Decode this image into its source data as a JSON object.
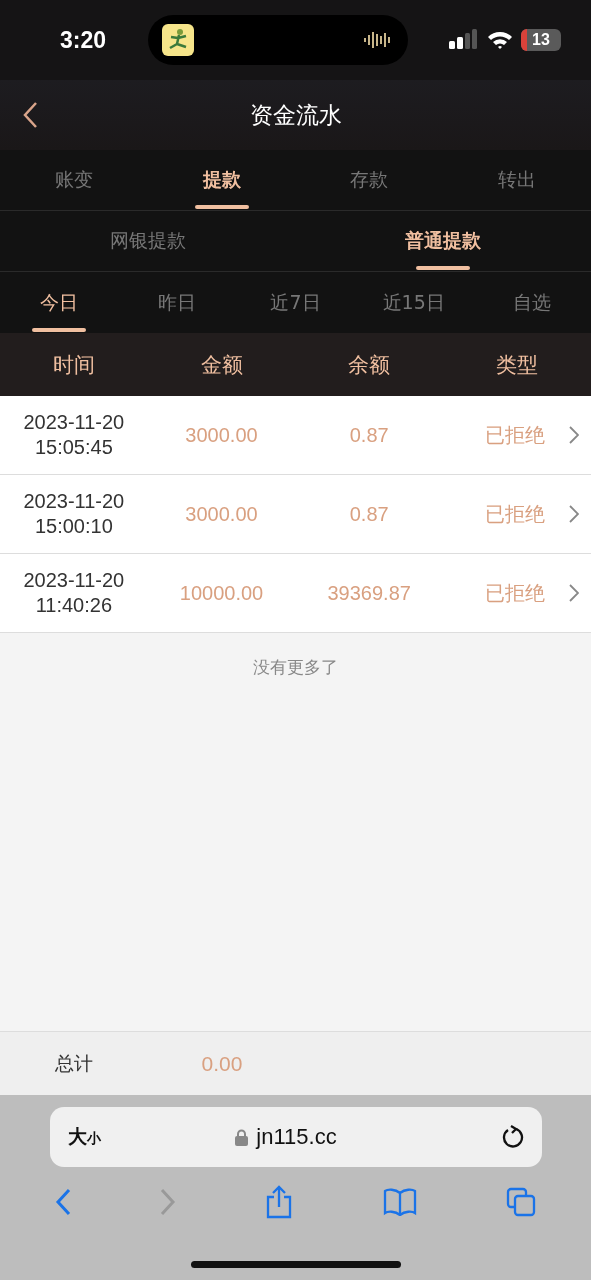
{
  "status_bar": {
    "time": "3:20",
    "battery": "13"
  },
  "header": {
    "title": "资金流水"
  },
  "tabs": [
    {
      "label": "账变",
      "selected": false
    },
    {
      "label": "提款",
      "selected": true
    },
    {
      "label": "存款",
      "selected": false
    },
    {
      "label": "转出",
      "selected": false
    }
  ],
  "sub_tabs": [
    {
      "label": "网银提款",
      "selected": false
    },
    {
      "label": "普通提款",
      "selected": true
    }
  ],
  "date_tabs": [
    {
      "label": "今日",
      "selected": true
    },
    {
      "label": "昨日",
      "selected": false
    },
    {
      "label": "近7日",
      "selected": false
    },
    {
      "label": "近15日",
      "selected": false
    },
    {
      "label": "自选",
      "selected": false
    }
  ],
  "table": {
    "columns": [
      "时间",
      "金额",
      "余额",
      "类型"
    ],
    "rows": [
      {
        "date": "2023-11-20",
        "time": "15:05:45",
        "amount": "3000.00",
        "balance": "0.87",
        "status": "已拒绝"
      },
      {
        "date": "2023-11-20",
        "time": "15:00:10",
        "amount": "3000.00",
        "balance": "0.87",
        "status": "已拒绝"
      },
      {
        "date": "2023-11-20",
        "time": "11:40:26",
        "amount": "10000.00",
        "balance": "39369.87",
        "status": "已拒绝"
      }
    ],
    "end_note": "没有更多了"
  },
  "total": {
    "label": "总计",
    "value": "0.00"
  },
  "browser": {
    "text_size": "大小",
    "url": "jn115.cc"
  }
}
